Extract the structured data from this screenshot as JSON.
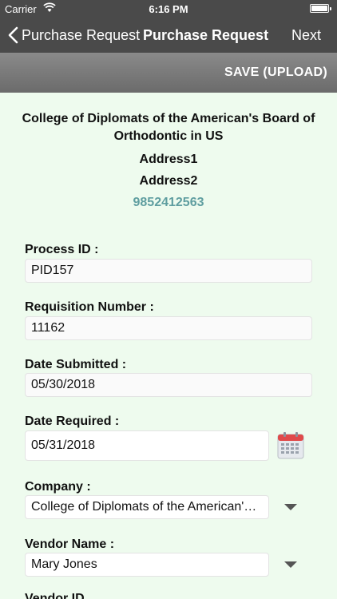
{
  "status": {
    "carrier": "Carrier",
    "time": "6:16 PM"
  },
  "nav": {
    "back_label": "Purchase Request",
    "title": "Purchase Request",
    "next_label": "Next"
  },
  "toolbar": {
    "save_label": "SAVE (UPLOAD)"
  },
  "org": {
    "name": "College of Diplomats of the American's Board of Orthodontic in US",
    "address1": "Address1",
    "address2": "Address2",
    "phone": "9852412563"
  },
  "fields": {
    "process_id": {
      "label": "Process ID :",
      "value": "PID157"
    },
    "requisition_number": {
      "label": "Requisition Number :",
      "value": "11162"
    },
    "date_submitted": {
      "label": "Date Submitted :",
      "value": "05/30/2018"
    },
    "date_required": {
      "label": "Date Required :",
      "value": "05/31/2018"
    },
    "company": {
      "label": "Company :",
      "value": "College of Diplomats of the American's Board of Orthodontic in US"
    },
    "vendor_name": {
      "label": "Vendor Name :",
      "value": "Mary Jones"
    },
    "vendor_id": {
      "label": "Vendor ID"
    }
  },
  "icons": {
    "calendar": "calendar-icon",
    "dropdown": "chevron-down-icon",
    "back": "chevron-left-icon"
  },
  "colors": {
    "bar": "#4a4a4a",
    "background": "#eefbee",
    "phone": "#5f9ea0",
    "calendar_red": "#e04a4a"
  }
}
